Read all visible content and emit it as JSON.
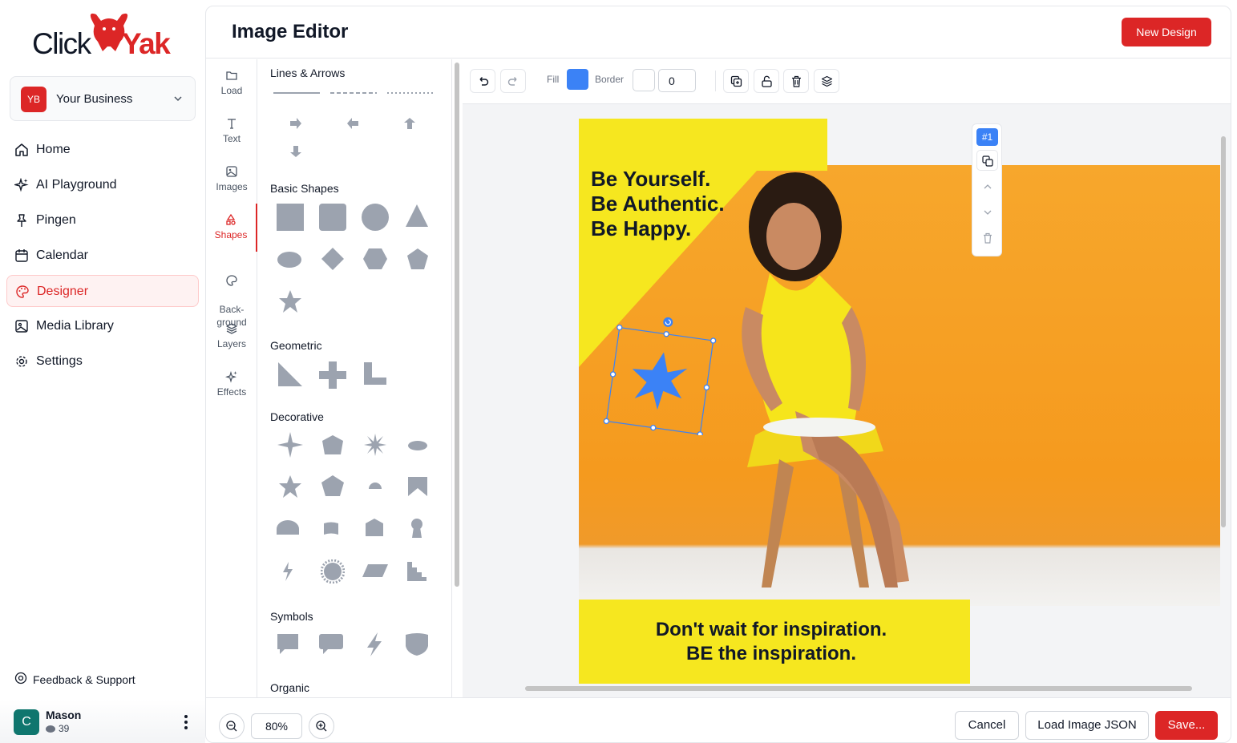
{
  "brand": {
    "word1": "Click",
    "word2": "Yak",
    "accent": "#dc2626"
  },
  "business": {
    "initials": "YB",
    "name": "Your Business"
  },
  "nav": [
    {
      "label": "Home",
      "icon": "home-icon"
    },
    {
      "label": "AI Playground",
      "icon": "sparkles-icon"
    },
    {
      "label": "Pingen",
      "icon": "pin-icon"
    },
    {
      "label": "Calendar",
      "icon": "calendar-icon"
    },
    {
      "label": "Designer",
      "icon": "palette-icon",
      "active": true
    },
    {
      "label": "Media Library",
      "icon": "image-gallery-icon"
    },
    {
      "label": "Settings",
      "icon": "gear-icon"
    }
  ],
  "feedback": "Feedback & Support",
  "user": {
    "initial": "C",
    "name": "Mason",
    "credits": "39"
  },
  "header": {
    "title": "Image Editor",
    "new_design": "New Design"
  },
  "rail": [
    {
      "label": "Load",
      "icon": "folder-icon"
    },
    {
      "label": "Text",
      "icon": "text-icon"
    },
    {
      "label": "Images",
      "icon": "image-icon"
    },
    {
      "label": "Shapes",
      "icon": "shapes-icon",
      "active": true
    },
    {
      "label": "Back-\nground",
      "icon": "palette-icon"
    },
    {
      "label": "Layers",
      "icon": "layers-icon"
    },
    {
      "label": "Effects",
      "icon": "sparkles-icon"
    }
  ],
  "sections": {
    "lines": "Lines & Arrows",
    "basic": "Basic Shapes",
    "geometric": "Geometric",
    "decorative": "Decorative",
    "symbols": "Symbols",
    "organic": "Organic"
  },
  "toolbar": {
    "fill_label": "Fill",
    "border_label": "Border",
    "border_width": "0",
    "fill_color": "#3b82f6"
  },
  "design": {
    "headline": [
      "Be Yourself.",
      "Be Authentic.",
      "Be Happy."
    ],
    "banner": [
      "Don't wait for inspiration.",
      "BE the inspiration."
    ],
    "yellow": "#f6e71f"
  },
  "selection": {
    "index": "#1"
  },
  "footer": {
    "zoom": "80%",
    "cancel": "Cancel",
    "load_json": "Load Image JSON",
    "save": "Save..."
  }
}
